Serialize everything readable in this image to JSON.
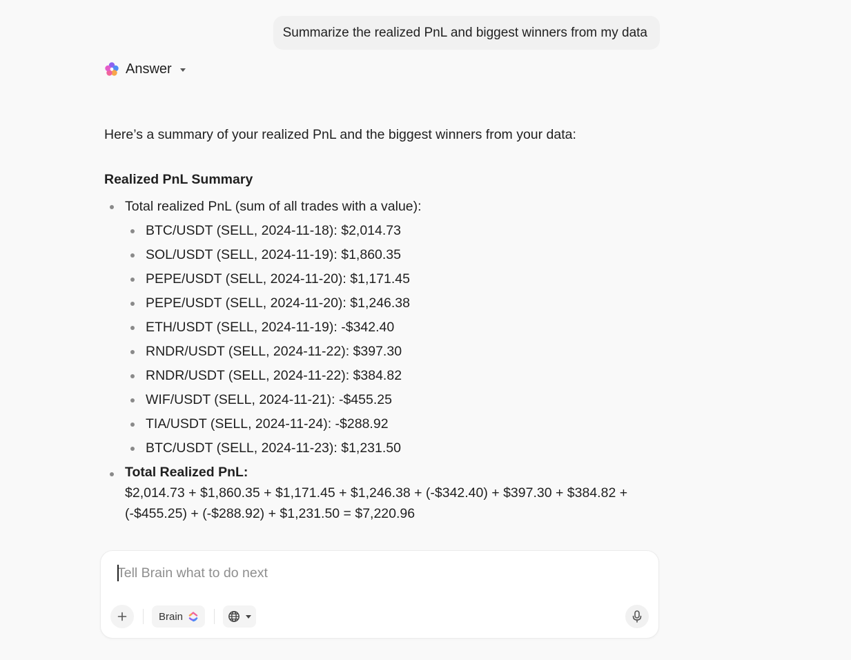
{
  "user_message": "Summarize the realized PnL and biggest winners from my data",
  "answer_header": {
    "label": "Answer"
  },
  "response": {
    "intro": "Here’s a summary of your realized PnL and the biggest winners from your data:",
    "section_title": "Realized PnL Summary",
    "total_intro": "Total realized PnL (sum of all trades with a value):",
    "trades": [
      "BTC/USDT (SELL, 2024-11-18): $2,014.73",
      "SOL/USDT (SELL, 2024-11-19): $1,860.35",
      "PEPE/USDT (SELL, 2024-11-20): $1,171.45",
      "PEPE/USDT (SELL, 2024-11-20): $1,246.38",
      "ETH/USDT (SELL, 2024-11-19): -$342.40",
      "RNDR/USDT (SELL, 2024-11-22): $397.30",
      "RNDR/USDT (SELL, 2024-11-22): $384.82",
      "WIF/USDT (SELL, 2024-11-21): -$455.25",
      "TIA/USDT (SELL, 2024-11-24): -$288.92",
      "BTC/USDT (SELL, 2024-11-23): $1,231.50"
    ],
    "total_label": "Total Realized PnL:",
    "total_calc_line1": "$2,014.73 + $1,860.35 + $1,171.45 + $1,246.38 + (-$342.40) + $397.30 + $384.82 +",
    "total_calc_line2": "(-$455.25) + (-$288.92) + $1,231.50 = $7,220.96"
  },
  "composer": {
    "placeholder": "Tell Brain what to do next",
    "value": "",
    "brain_label": "Brain"
  },
  "icons": {
    "answer_logo": "flower-logo-icon",
    "answer_caret": "caret-down-icon",
    "add": "plus-icon",
    "brain_logo": "brain-logo-icon",
    "web": "globe-icon",
    "web_caret": "caret-down-icon",
    "voice": "microphone-icon"
  },
  "colors": {
    "background": "#f9f9f9",
    "bubble": "#f1f1f1",
    "text": "#1f1f1f",
    "placeholder": "#8e8e8e",
    "logo_pink": "#f0649c",
    "logo_purple": "#8d63f0",
    "logo_blue": "#4f8df5",
    "logo_orange": "#f7a64a"
  }
}
